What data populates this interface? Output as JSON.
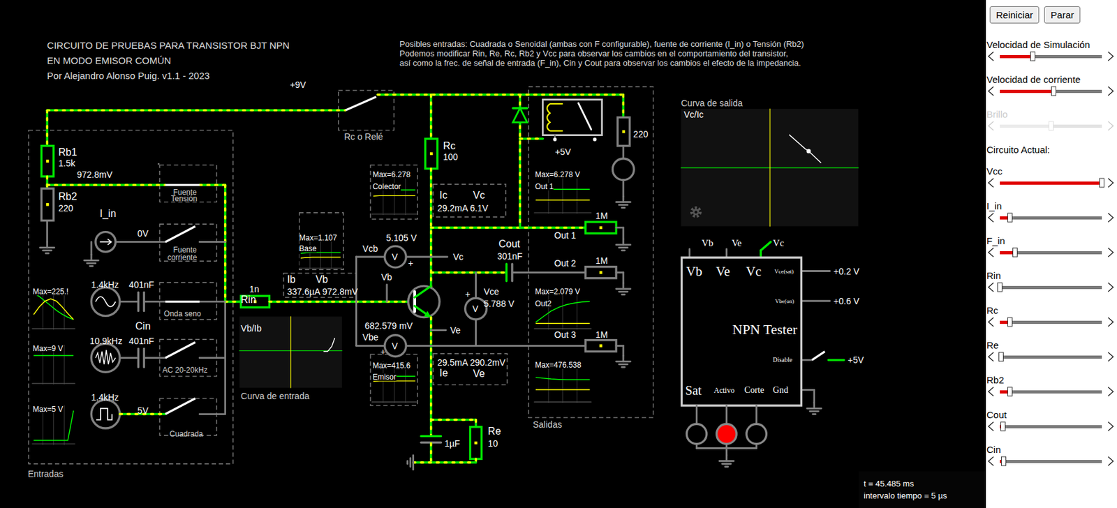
{
  "header": {
    "title_lines": [
      "CIRCUITO DE PRUEBAS PARA TRANSISTOR BJT NPN",
      "EN MODO EMISOR COMÚN",
      "Por Alejandro Alonso Puig. v1.1 - 2023"
    ],
    "notes_lines": [
      "Posibles entradas: Cuadrada o Senoidal (ambas con F configurable), fuente de corriente (I_in) o Tensión (Rb2)",
      "Podemos modificar Rin, Re, Rc, Rb2 y Vcc para observar los cambios en el comportamiento del transistor,",
      "así como la frec. de señal de entrada (F_in), Cin y Cout para observar los cambios el efecto de la impedancia."
    ]
  },
  "circuit": {
    "labels": {
      "vcc": "+9V",
      "rb1": "Rb1",
      "rb1_val": "1.5k",
      "node_base_v": "972.8mV",
      "rb2": "Rb2",
      "rb2_val": "220",
      "i_in": "I_in",
      "i_in_v": "0V",
      "sw_tension_1": "Fuente",
      "sw_tension_2": "Tensión",
      "sw_corriente_1": "Fuente",
      "sw_corriente_2": "corriente",
      "sine_f": "1.4kHz",
      "sine_c": "401nF",
      "sw_seno": "Onda seno",
      "cin": "Cin",
      "ac_f": "10.9kHz",
      "ac_c": "401nF",
      "sw_ac": "AC 20-20kHz",
      "sq_f": "1.4kHz",
      "sq_v": "5V",
      "sw_sq": "Cuadrada",
      "entradas": "Entradas",
      "rin": "Rin",
      "rin_val": "1n",
      "ib": "Ib",
      "vb_lbl": "Vb",
      "ib_vb_vals": "337.6µA 972.8mV",
      "rc_sw": "Rc o Relé",
      "rc": "Rc",
      "rc_val": "100",
      "ic": "Ic",
      "vc_lbl": "Vc",
      "ic_vc_vals": "29.2mA 6.1V",
      "vcb_val": "5.105 V",
      "vcb": "Vcb",
      "vb_probe": "Vb",
      "vc_probe": "Vc",
      "cout": "Cout",
      "cout_val": "301nF",
      "vce": "Vce",
      "vce_val": "5.788 V",
      "vbe_val": "682.579 mV",
      "vbe": "Vbe",
      "ve_probe": "Ve",
      "ie_ve_vals": "29.5mA 290.2mV",
      "ie": "Ie",
      "ve_lbl": "Ve",
      "c1": "1µF",
      "re": "Re",
      "re_val": "10",
      "relay_v": "+5V",
      "lamp_r": "220",
      "r_out1": "1M",
      "out1": "Out 1",
      "r_out2": "1M",
      "out2": "Out 2",
      "r_out3": "1M",
      "out3": "Out 3",
      "salidas": "Salidas",
      "curva_salida": "Curva de salida",
      "vcic": "Vc/Ic",
      "vbib": "Vb/Ib",
      "curva_entrada": "Curva de entrada",
      "mv_vcb": "V",
      "mv_vce": "V",
      "mv_vbe": "V",
      "plus_vcb": "+",
      "plus_vce": "+",
      "plus_vbe": "+"
    }
  },
  "switches": {
    "tension": {
      "closed": true
    },
    "corriente": {
      "closed": false
    },
    "seno": {
      "closed": true
    },
    "ac": {
      "closed": false
    },
    "cuadrada": {
      "closed": false
    },
    "rc_rele": {
      "rc_selected": true
    },
    "disable": {
      "closed": false
    }
  },
  "scopes": [
    {
      "max": "Max=225.!",
      "label": "",
      "traces": [
        {
          "color": "#00ff00",
          "values": [
            0.9,
            0.82,
            0.7,
            0.58,
            0.46,
            0.36,
            0.28,
            0.22
          ]
        },
        {
          "color": "#ffff00",
          "values": [
            0.35,
            0.55,
            0.7,
            0.76,
            0.7,
            0.55,
            0.38,
            0.22
          ]
        }
      ]
    },
    {
      "max": "Max=9 V",
      "label": "",
      "traces": [
        {
          "color": "#00ff00",
          "values": [
            0.75,
            0.75,
            0.75,
            0.75,
            0.75,
            0.75,
            0.75,
            0.75
          ]
        }
      ]
    },
    {
      "max": "Max=5 V",
      "label": "",
      "traces": [
        {
          "color": "#00ff00",
          "values": [
            0.08,
            0.08,
            0.08,
            0.08,
            0.08,
            0.08,
            0.08,
            0.9
          ]
        }
      ]
    },
    {
      "max": "Max=1.107",
      "label": "Base",
      "traces": [
        {
          "color": "#00ff00",
          "values": [
            0.45,
            0.47,
            0.48,
            0.48,
            0.48,
            0.48,
            0.48,
            0.48
          ]
        },
        {
          "color": "#ffff00",
          "values": [
            0.3,
            0.32,
            0.33,
            0.33,
            0.33,
            0.33,
            0.33,
            0.33
          ]
        }
      ]
    },
    {
      "max": "Max=6.278",
      "label": "Colector",
      "traces": [
        {
          "color": "#00ff00",
          "values": [
            0.6,
            0.58,
            0.57,
            0.57,
            0.57,
            0.57,
            0.57,
            0.57
          ]
        },
        {
          "color": "#ffff00",
          "values": [
            0.42,
            0.43,
            0.43,
            0.43,
            0.43,
            0.43,
            0.43,
            0.43
          ]
        }
      ]
    },
    {
      "max": "Max=415.6",
      "label": "Emisor",
      "traces": [
        {
          "color": "#00ff00",
          "values": [
            0.62,
            0.64,
            0.65,
            0.65,
            0.65,
            0.65,
            0.65,
            0.65
          ]
        },
        {
          "color": "#ffff00",
          "values": [
            0.52,
            0.53,
            0.53,
            0.53,
            0.53,
            0.53,
            0.53,
            0.53
          ]
        }
      ]
    },
    {
      "max": "Max=6.278 V",
      "label": "Out 1",
      "traces": [
        {
          "color": "#00ff00",
          "values": [
            0.6,
            0.58,
            0.57,
            0.57,
            0.57,
            0.57,
            0.57,
            0.57
          ]
        },
        {
          "color": "#ffff00",
          "values": [
            0.3,
            0.3,
            0.3,
            0.3,
            0.3,
            0.3,
            0.3,
            0.3
          ]
        }
      ]
    },
    {
      "max": "Max=2.079 V",
      "label": "Out2",
      "traces": [
        {
          "color": "#00ff00",
          "values": [
            0.15,
            0.3,
            0.44,
            0.54,
            0.61,
            0.65,
            0.68,
            0.69
          ]
        },
        {
          "color": "#ffff00",
          "values": [
            0.12,
            0.12,
            0.12,
            0.12,
            0.12,
            0.12,
            0.12,
            0.12
          ]
        }
      ]
    },
    {
      "max": "Max=476.538",
      "label": "",
      "traces": [
        {
          "color": "#00ff00",
          "values": [
            0.62,
            0.6,
            0.58,
            0.57,
            0.56,
            0.56,
            0.56,
            0.56
          ]
        },
        {
          "color": "#ffff00",
          "values": [
            0.3,
            0.3,
            0.3,
            0.3,
            0.3,
            0.3,
            0.3,
            0.3
          ]
        }
      ]
    }
  ],
  "xy_plots": [
    {
      "points": [
        [
          0.82,
          0.49
        ],
        [
          0.86,
          0.49
        ],
        [
          0.9,
          0.42
        ],
        [
          0.93,
          0.3
        ]
      ]
    },
    {
      "points": [
        [
          0.61,
          0.22
        ],
        [
          0.7,
          0.34
        ],
        [
          0.72,
          0.36
        ],
        [
          0.79,
          0.46
        ]
      ],
      "cursor": [
        0.72,
        0.36
      ]
    }
  ],
  "tester": {
    "pins": [
      "Vb",
      "Ve",
      "Vc"
    ],
    "big_pins": [
      "Vb",
      "Ve",
      "Vc"
    ],
    "vcesat": "Vce(sat)",
    "vcesat_v": "+0.2 V",
    "vbeon": "Vbe(on)",
    "vbeon_v": "+0.6 V",
    "title": "NPN Tester",
    "disable": "Disable",
    "disable_v": "+5V",
    "gnd": "Gnd",
    "leds": [
      {
        "label": "Sat",
        "on": false
      },
      {
        "label": "Activo",
        "on": true
      },
      {
        "label": "Corte",
        "on": false
      }
    ]
  },
  "status": {
    "time": "t = 45.485 ms",
    "step": "intervalo tiempo = 5 µs"
  },
  "panel": {
    "buttons": [
      "Reiniciar",
      "Parar"
    ],
    "sim_sliders": [
      {
        "label": "Velocidad de Simulación",
        "level": 0.32,
        "disabled": false
      },
      {
        "label": "Velocidad de corriente",
        "level": 0.53,
        "disabled": false
      },
      {
        "label": "Brillo",
        "level": 0.5,
        "disabled": true
      }
    ],
    "section_title": "Circuito Actual:",
    "circuit_sliders": [
      {
        "label": "Vcc",
        "level": 1.0,
        "disabled": false
      },
      {
        "label": "I_in",
        "level": 0.1,
        "disabled": false
      },
      {
        "label": "F_in",
        "level": 0.15,
        "disabled": false
      },
      {
        "label": "Rin",
        "level": 0.0,
        "disabled": false
      },
      {
        "label": "Rc",
        "level": 0.1,
        "disabled": false
      },
      {
        "label": "Re",
        "level": 0.01,
        "disabled": false
      },
      {
        "label": "Rb2",
        "level": 0.1,
        "disabled": false
      },
      {
        "label": "Cout",
        "level": 0.03,
        "disabled": false
      },
      {
        "label": "Cin",
        "level": 0.04,
        "disabled": false
      }
    ]
  }
}
